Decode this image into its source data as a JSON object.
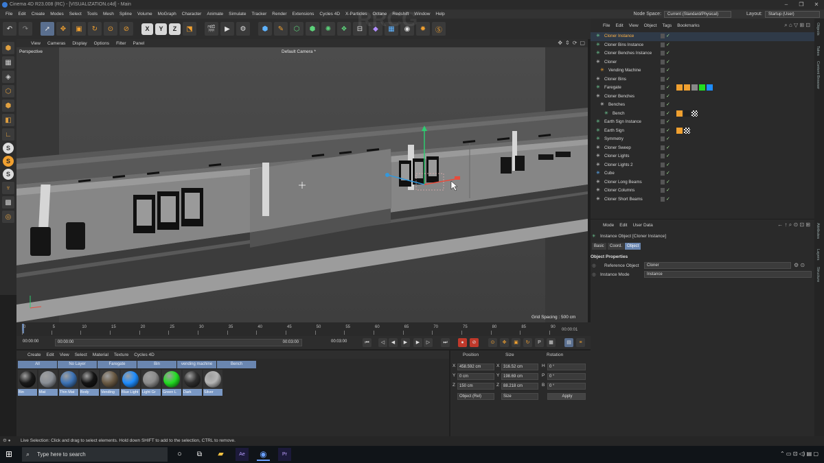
{
  "window": {
    "title": "Cinema 4D R23.008 (RC) - [VISUALIZATION.c4d] - Main",
    "controls": [
      "–",
      "❐",
      "✕"
    ]
  },
  "menubar": {
    "items": [
      "File",
      "Edit",
      "Create",
      "Modes",
      "Select",
      "Tools",
      "Mesh",
      "Spline",
      "Volume",
      "MoGraph",
      "Character",
      "Animate",
      "Simulate",
      "Tracker",
      "Render",
      "Extensions",
      "Cycles 4D",
      "X-Particles",
      "Octane",
      "Redshift",
      "Window",
      "Help"
    ],
    "node_space_label": "Node Space:",
    "node_space_value": "Current (Standard/Physical)",
    "layout_label": "Layout:",
    "layout_value": "Startup (User)"
  },
  "viewport": {
    "menu": [
      "View",
      "Cameras",
      "Display",
      "Options",
      "Filter",
      "Panel"
    ],
    "view_name": "Perspective",
    "camera_name": "Default Camera *",
    "grid_spacing": "Grid Spacing : 500 cm"
  },
  "timeline": {
    "ticks": [
      "0",
      "5",
      "10",
      "15",
      "20",
      "25",
      "30",
      "35",
      "40",
      "45",
      "50",
      "55",
      "60",
      "65",
      "70",
      "75",
      "80",
      "85",
      "90"
    ],
    "current_frame": "00:00:01",
    "start": "00:00:00",
    "preview_start": "00:00:00",
    "preview_end": "00:03:00",
    "end": "00:03:00"
  },
  "material_panel": {
    "menu": [
      "Create",
      "Edit",
      "View",
      "Select",
      "Material",
      "Texture",
      "Cycles 4D"
    ],
    "layers": [
      "All",
      "No Layer",
      "Faregate",
      "Bin",
      "vending machine",
      "Bench"
    ],
    "materials": [
      {
        "name": "Bin",
        "color": "#1a1a1a"
      },
      {
        "name": "Mat",
        "color": "#8a8f96"
      },
      {
        "name": "Thin Mat",
        "color": "#3d73b5"
      },
      {
        "name": "Body",
        "color": "#141414"
      },
      {
        "name": "Vending",
        "color": "#6a5a44"
      },
      {
        "name": "Blue Light",
        "color": "#1e8dff"
      },
      {
        "name": "Light Gr",
        "color": "#8c8c8c"
      },
      {
        "name": "Green L",
        "color": "#22dd22"
      },
      {
        "name": "Dark",
        "color": "#2e2e2e"
      },
      {
        "name": "Silver",
        "color": "#b5b5b5"
      }
    ]
  },
  "coordinates": {
    "headers": [
      "Position",
      "Size",
      "Rotation"
    ],
    "rows": [
      {
        "axis": "X",
        "pos": "458.592 cm",
        "size_axis": "X",
        "size": "316.52 cm",
        "rot_axis": "H",
        "rot": "0 °"
      },
      {
        "axis": "Y",
        "pos": "0 cm",
        "size_axis": "Y",
        "size": "198.69 cm",
        "rot_axis": "P",
        "rot": "0 °"
      },
      {
        "axis": "Z",
        "pos": "150 cm",
        "size_axis": "Z",
        "size": "88.218 cm",
        "rot_axis": "B",
        "rot": "0 °"
      }
    ],
    "mode": "Object (Rel)",
    "size_mode": "Size",
    "apply": "Apply"
  },
  "object_manager": {
    "menu": [
      "File",
      "Edit",
      "View",
      "Object",
      "Tags",
      "Bookmarks"
    ],
    "objects": [
      {
        "name": "Cloner Instance",
        "indent": 0,
        "highlight": true,
        "icon_color": "#6fcf97"
      },
      {
        "name": "Cloner Bins Instance",
        "indent": 0,
        "highlight": false,
        "icon_color": "#6fcf97"
      },
      {
        "name": "Cloner  Benches Instance",
        "indent": 0,
        "highlight": false,
        "icon_color": "#6fcf97"
      },
      {
        "name": "Cloner",
        "indent": 0,
        "highlight": false,
        "icon_color": "#dddddd"
      },
      {
        "name": "Vending Machine",
        "indent": 1,
        "highlight": false,
        "icon_color": "#f0a030"
      },
      {
        "name": "Cloner Bins",
        "indent": 0,
        "highlight": false,
        "icon_color": "#dddddd"
      },
      {
        "name": "Faregate",
        "indent": 0,
        "highlight": false,
        "icon_color": "#6fcf97"
      },
      {
        "name": "Cloner  Benches",
        "indent": 0,
        "highlight": false,
        "icon_color": "#dddddd"
      },
      {
        "name": "Benches",
        "indent": 1,
        "highlight": false,
        "icon_color": "#dddddd"
      },
      {
        "name": "Bench",
        "indent": 2,
        "highlight": false,
        "icon_color": "#6fcf97"
      },
      {
        "name": "Earth Sign Instance",
        "indent": 0,
        "highlight": false,
        "icon_color": "#6fcf97"
      },
      {
        "name": "Earth Sign",
        "indent": 0,
        "highlight": false,
        "icon_color": "#6fcf97"
      },
      {
        "name": "Symmetry",
        "indent": 0,
        "highlight": false,
        "icon_color": "#6fcf97"
      },
      {
        "name": "Cloner Sweep",
        "indent": 0,
        "highlight": false,
        "icon_color": "#dddddd"
      },
      {
        "name": "Cloner Lights",
        "indent": 0,
        "highlight": false,
        "icon_color": "#dddddd"
      },
      {
        "name": "Cloner Lights 2",
        "indent": 0,
        "highlight": false,
        "icon_color": "#dddddd"
      },
      {
        "name": "Cube",
        "indent": 0,
        "highlight": false,
        "icon_color": "#5fb3ff"
      },
      {
        "name": "Cloner Long Beams",
        "indent": 0,
        "highlight": false,
        "icon_color": "#dddddd"
      },
      {
        "name": "Cloner Columns",
        "indent": 0,
        "highlight": false,
        "icon_color": "#dddddd"
      },
      {
        "name": "Cloner Short Beams",
        "indent": 0,
        "highlight": false,
        "icon_color": "#dddddd"
      }
    ]
  },
  "attribute_manager": {
    "menu": [
      "Mode",
      "Edit",
      "User Data"
    ],
    "object_title": "Instance Object [Cloner Instance]",
    "tabs": [
      "Basic",
      "Coord.",
      "Object"
    ],
    "active_tab": "Object",
    "section": "Object Properties",
    "reference_label": "Reference Object",
    "reference_value": "Cloner",
    "mode_label": "Instance Mode",
    "mode_value": "Instance"
  },
  "right_vtabs": [
    "Objects",
    "Takes",
    "Content Browser",
    "Attributes",
    "Layers",
    "Structure"
  ],
  "statusbar": {
    "text": "Live Selection: Click and drag to select elements. Hold down SHIFT to add to the selection, CTRL to remove."
  },
  "taskbar": {
    "search_placeholder": "Type here to search",
    "apps": [
      "Ae",
      "Pr"
    ]
  },
  "watermark": "RRCG"
}
